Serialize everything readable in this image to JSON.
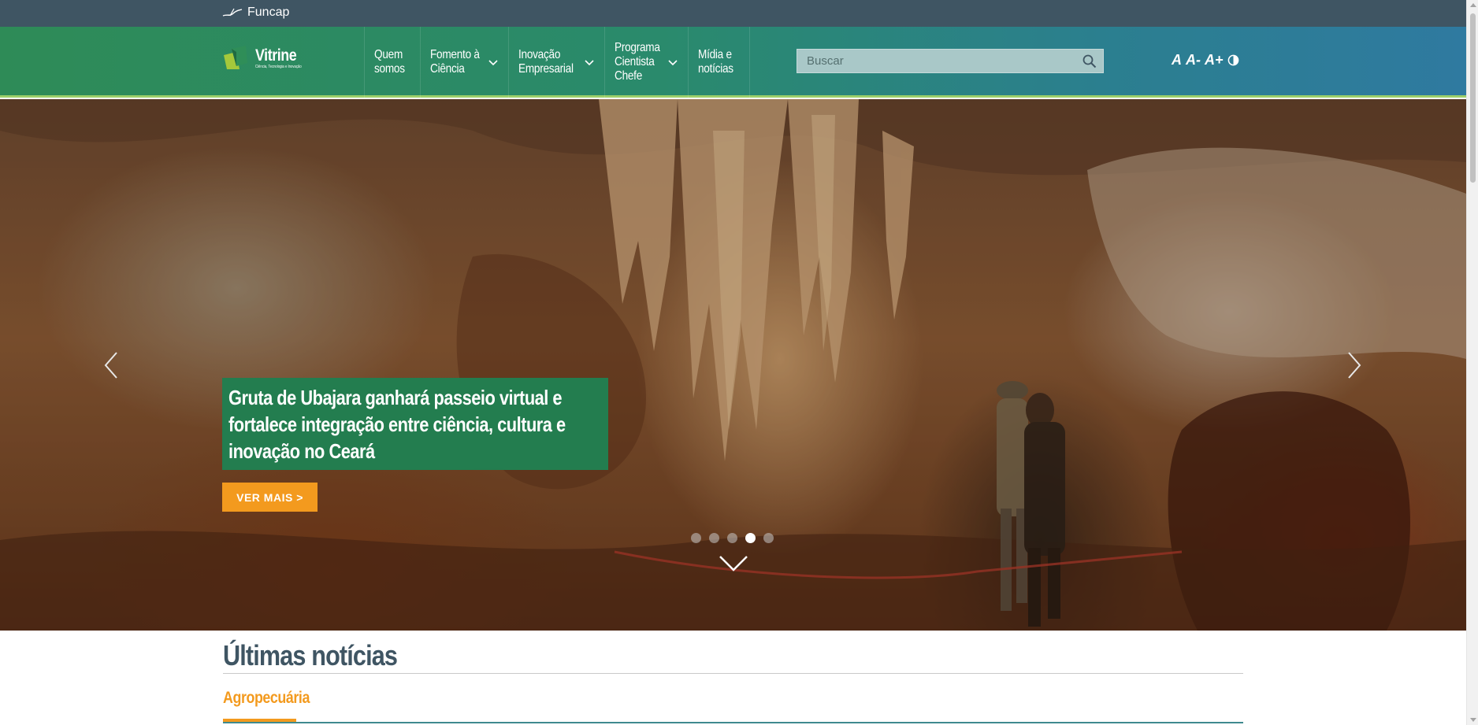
{
  "gov_bar": {
    "link_label": "Funcap"
  },
  "header": {
    "logo": {
      "title": "Vitrine",
      "subtitle": "Ciência, Tecnologia e Inovação"
    },
    "nav": [
      {
        "label": "Quem\nsomos",
        "has_dropdown": false
      },
      {
        "label": "Fomento à\nCiência",
        "has_dropdown": true
      },
      {
        "label": "Inovação\nEmpresarial",
        "has_dropdown": true
      },
      {
        "label": "Programa\nCientista\nChefe",
        "has_dropdown": true
      },
      {
        "label": "Mídia e\nnotícias",
        "has_dropdown": false
      }
    ],
    "search": {
      "placeholder": "Buscar",
      "value": ""
    },
    "accessibility": {
      "font_default": "A",
      "font_decrease": "A-",
      "font_increase": "A+",
      "contrast_icon": "contrast-icon"
    }
  },
  "hero": {
    "caption": "Gruta de Ubajara ganhará passeio virtual e fortalece integração entre ciência, cultura e inovação no Ceará",
    "cta_label": "VER MAIS >",
    "slide_count": 5,
    "active_slide": 4
  },
  "news": {
    "section_title": "Últimas notícias",
    "active_category": "Agropecuária"
  },
  "colors": {
    "gov_bar": "#3f5563",
    "header_green": "#2e8b57",
    "header_blue": "#2f7aa0",
    "caption_green": "#237d4f",
    "accent_orange": "#f39a1e",
    "title_slate": "#3f5563"
  }
}
